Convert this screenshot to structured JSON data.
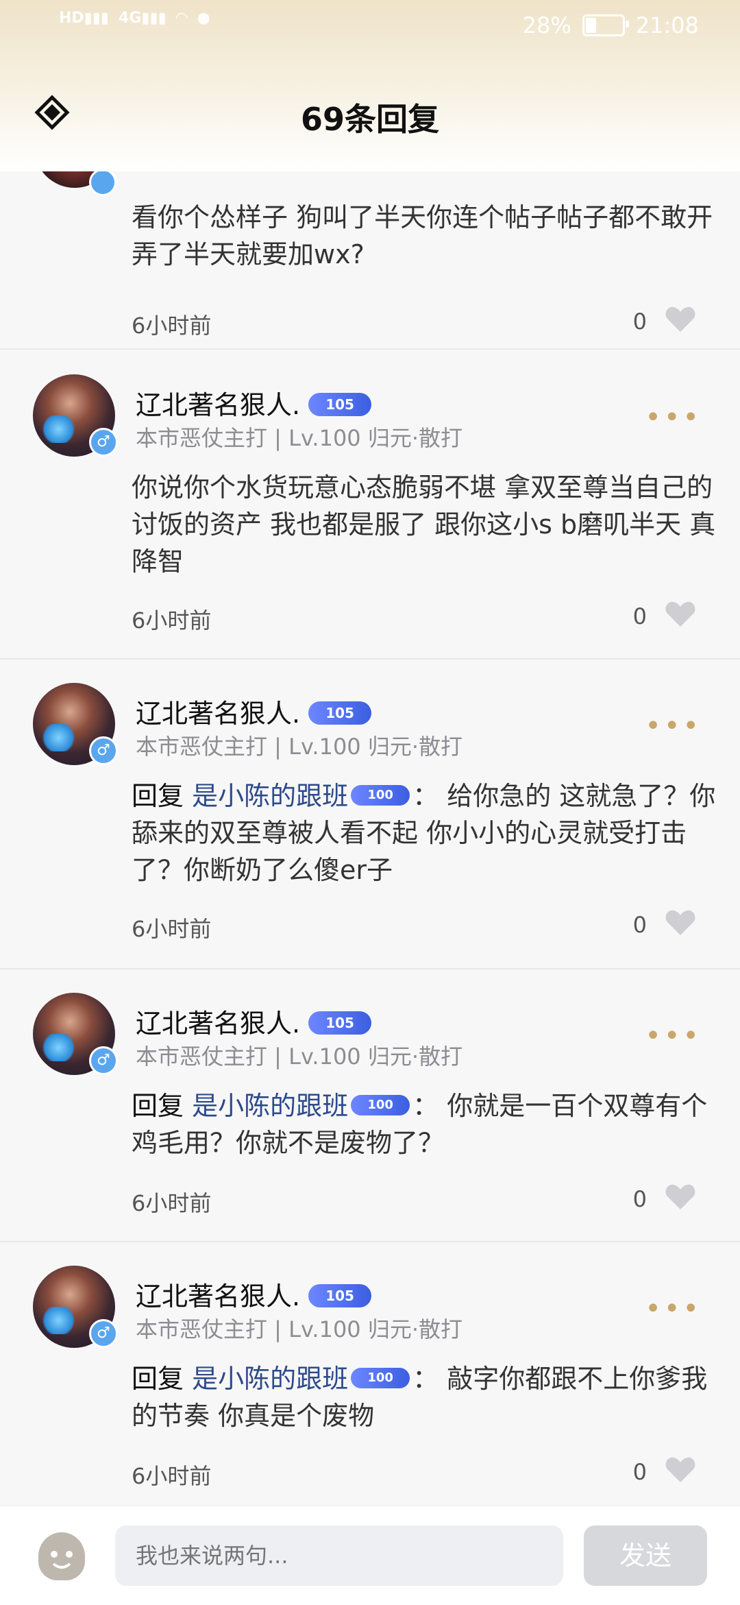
{
  "status_bar": {
    "battery_percent": "28%",
    "time": "21:08"
  },
  "header": {
    "title": "69条回复"
  },
  "partial_reply": {
    "content": "看你个怂样子 狗叫了半天你连个帖子帖子都不敢开 弄了半天就要加wx?",
    "time": "6小时前",
    "likes": "0"
  },
  "replies": [
    {
      "username": "辽北著名狠人.",
      "level_badge": "105",
      "meta": "本市恶仗主打 | Lv.100 归元·散打",
      "content": "你说你个水货玩意心态脆弱不堪 拿双至尊当自己的讨饭的资产 我也都是服了 跟你这小s b磨叽半天 真降智",
      "time": "6小时前",
      "likes": "0"
    },
    {
      "username": "辽北著名狠人.",
      "level_badge": "105",
      "meta": "本市恶仗主打 | Lv.100 归元·散打",
      "reply_prefix": "回复",
      "reply_target": "是小陈的跟班",
      "target_badge": "100",
      "content": "：  给你急的 这就急了？你舔来的双至尊被人看不起 你小小的心灵就受打击了？你断奶了么傻er子",
      "time": "6小时前",
      "likes": "0"
    },
    {
      "username": "辽北著名狠人.",
      "level_badge": "105",
      "meta": "本市恶仗主打 | Lv.100 归元·散打",
      "reply_prefix": "回复",
      "reply_target": "是小陈的跟班",
      "target_badge": "100",
      "content": "：  你就是一百个双尊有个鸡毛用？你就不是废物了？",
      "time": "6小时前",
      "likes": "0"
    },
    {
      "username": "辽北著名狠人.",
      "level_badge": "105",
      "meta": "本市恶仗主打 | Lv.100 归元·散打",
      "reply_prefix": "回复",
      "reply_target": "是小陈的跟班",
      "target_badge": "100",
      "content": "：  敲字你都跟不上你爹我的节奏 你真是个废物",
      "time": "6小时前",
      "likes": "0"
    }
  ],
  "composer": {
    "placeholder": "我也来说两句...",
    "send_label": "发送"
  }
}
